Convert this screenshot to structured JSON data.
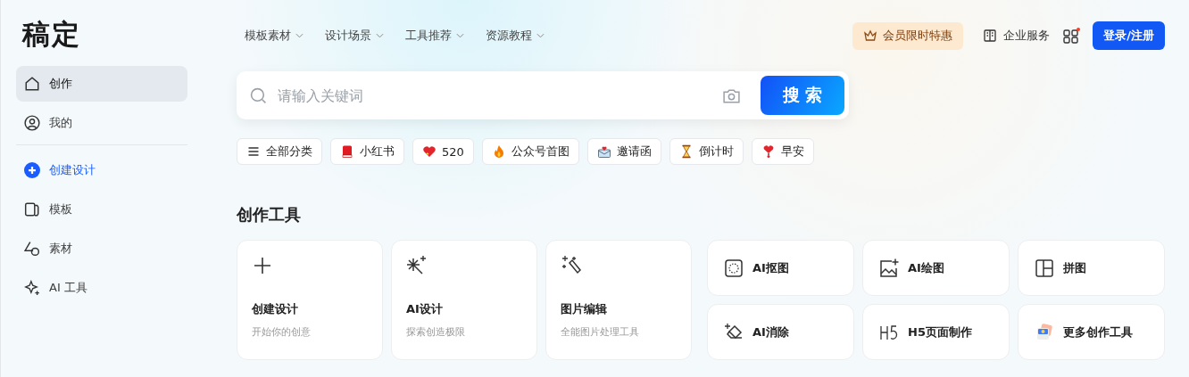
{
  "logo": "稿定",
  "nav": [
    {
      "label": "模板素材"
    },
    {
      "label": "设计场景"
    },
    {
      "label": "工具推荐"
    },
    {
      "label": "资源教程"
    }
  ],
  "header": {
    "promo": "会员限时特惠",
    "enterprise": "企业服务",
    "apps_notification": true,
    "login": "登录/注册"
  },
  "sidebar": {
    "primary": [
      {
        "label": "创作",
        "kind": "link",
        "selected": true
      },
      {
        "label": "我的",
        "kind": "link",
        "selected": false
      }
    ],
    "secondary": [
      {
        "label": "创建设计",
        "kind": "create",
        "selected": false
      },
      {
        "label": "模板",
        "kind": "link",
        "selected": false
      },
      {
        "label": "素材",
        "kind": "link",
        "selected": false
      },
      {
        "label": "AI 工具",
        "kind": "link",
        "selected": false
      }
    ]
  },
  "search": {
    "placeholder": "请输入关键词",
    "button": "搜 索"
  },
  "chips": [
    {
      "label": "全部分类"
    },
    {
      "label": "小红书"
    },
    {
      "label": "520"
    },
    {
      "label": "公众号首图"
    },
    {
      "label": "邀请函"
    },
    {
      "label": "倒计时"
    },
    {
      "label": "早安"
    }
  ],
  "section_title": "创作工具",
  "big_tools": [
    {
      "title": "创建设计",
      "subtitle": "开始你的创意"
    },
    {
      "title": "AI设计",
      "subtitle": "探索创造极限"
    },
    {
      "title": "图片编辑",
      "subtitle": "全能图片处理工具"
    }
  ],
  "small_tools": [
    {
      "label": "AI抠图"
    },
    {
      "label": "AI绘图"
    },
    {
      "label": "拼图"
    },
    {
      "label": "AI消除"
    },
    {
      "label": "H5页面制作"
    },
    {
      "label": "更多创作工具"
    }
  ]
}
